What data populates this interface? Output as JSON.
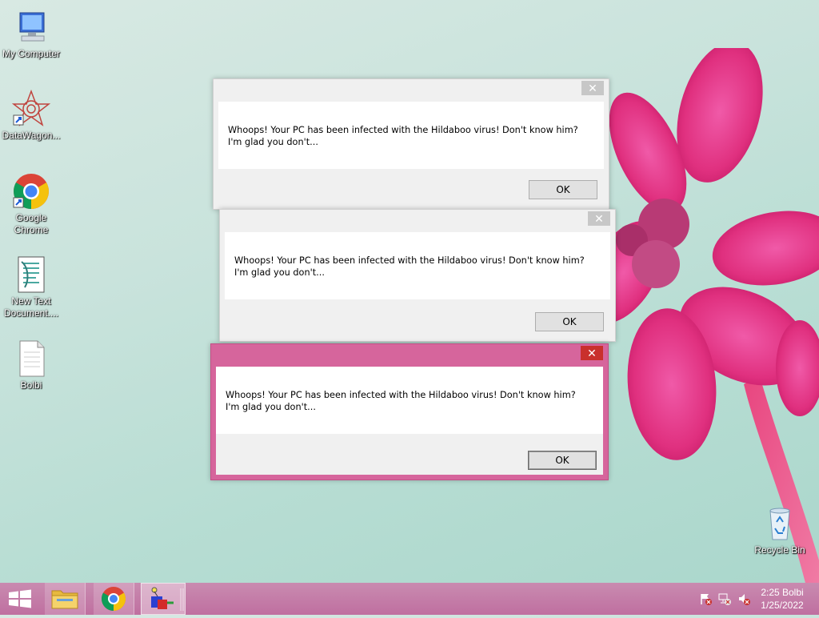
{
  "desktop": {
    "icons": [
      {
        "label": "My Computer",
        "icon": "computer-icon"
      },
      {
        "label": "DataWagon...",
        "icon": "datawagon-icon"
      },
      {
        "label": "Google Chrome",
        "icon": "chrome-icon"
      },
      {
        "label": "New Text Document....",
        "icon": "text-document-icon"
      },
      {
        "label": "Bolbi",
        "icon": "blank-file-icon"
      },
      {
        "label": "Recycle Bin",
        "icon": "recycle-bin-icon"
      }
    ]
  },
  "dialogs": [
    {
      "message": "Whoops! Your PC has been infected with the Hildaboo virus! Don't know him? I'm glad you don't...",
      "ok_label": "OK",
      "close_glyph": "✕",
      "state": "inactive"
    },
    {
      "message": "Whoops! Your PC has been infected with the Hildaboo virus! Don't know him? I'm glad you don't...",
      "ok_label": "OK",
      "close_glyph": "✕",
      "state": "inactive"
    },
    {
      "message": "Whoops! Your PC has been infected with the Hildaboo virus! Don't know him? I'm glad you don't...",
      "ok_label": "OK",
      "close_glyph": "✕",
      "state": "active"
    }
  ],
  "taskbar": {
    "start_icon": "windows-logo-icon",
    "pinned": [
      "file-explorer-icon",
      "chrome-icon",
      "app-cube-icon"
    ],
    "tray_icons": [
      "action-center-flag-icon",
      "network-icon",
      "volume-muted-icon"
    ],
    "clock": {
      "time": "2:25 Bolbi",
      "date": "1/25/2022"
    }
  },
  "colors": {
    "accent": "#d6659c",
    "close_active": "#c9302c",
    "taskbar": "#c57aa6"
  }
}
